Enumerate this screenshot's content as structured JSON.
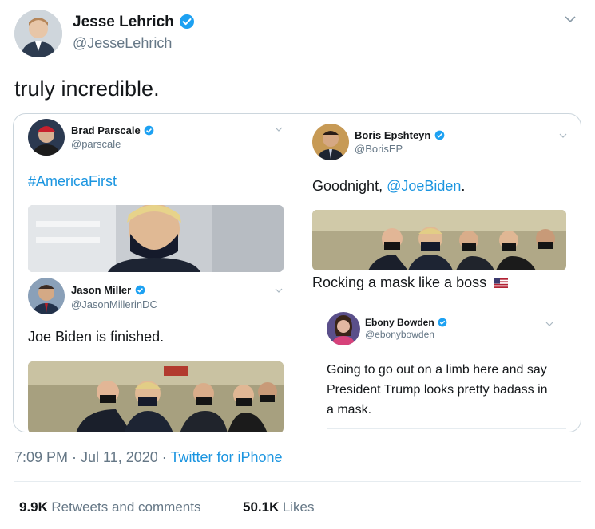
{
  "author": {
    "name": "Jesse Lehrich",
    "handle": "@JesseLehrich"
  },
  "tweet": {
    "text": "truly incredible."
  },
  "embedded": {
    "t1": {
      "name": "Brad Parscale",
      "handle": "@parscale",
      "text": "#AmericaFirst"
    },
    "t2": {
      "name": "Boris Epshteyn",
      "handle": "@BorisEP",
      "text_prefix": "Goodnight, ",
      "text_link": "@JoeBiden",
      "text_suffix": "."
    },
    "t3": {
      "name": "Jason Miller",
      "handle": "@JasonMillerinDC",
      "text": "Joe Biden is finished."
    },
    "t4": {
      "text": "Rocking a mask like a boss"
    },
    "t5": {
      "name": "Ebony Bowden",
      "handle": "@ebonybowden",
      "line1": "Going to go out on a limb here and say",
      "line2": "President Trump looks pretty badass in",
      "line3": "a mask."
    }
  },
  "meta": {
    "timestamp": "7:09 PM · Jul 11, 2020 · ",
    "source": "Twitter for iPhone"
  },
  "stats": {
    "retweets_count": "9.9K",
    "retweets_label": "Retweets and comments",
    "likes_count": "50.1K",
    "likes_label": "Likes"
  },
  "colors": {
    "accent": "#1b95e0",
    "verified": "#1da1f2",
    "muted": "#657786"
  },
  "icons": [
    "verified-badge-icon",
    "chevron-down-icon",
    "us-flag-icon"
  ]
}
